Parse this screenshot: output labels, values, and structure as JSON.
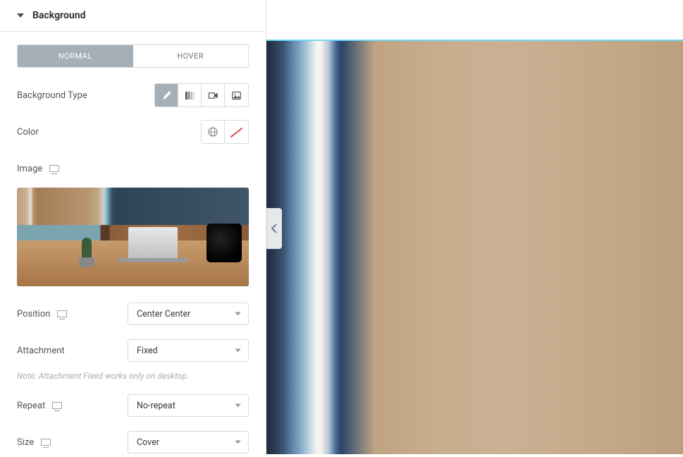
{
  "section": {
    "title": "Background"
  },
  "tabs": {
    "normal": "NORMAL",
    "hover": "HOVER",
    "active": "normal"
  },
  "bgtype": {
    "label": "Background Type",
    "active": "classic"
  },
  "color": {
    "label": "Color"
  },
  "image": {
    "label": "Image"
  },
  "position": {
    "label": "Position",
    "value": "Center Center"
  },
  "attachment": {
    "label": "Attachment",
    "value": "Fixed"
  },
  "note": "Note: Attachment Fixed works only on desktop.",
  "repeat": {
    "label": "Repeat",
    "value": "No-repeat"
  },
  "size": {
    "label": "Size",
    "value": "Cover"
  }
}
